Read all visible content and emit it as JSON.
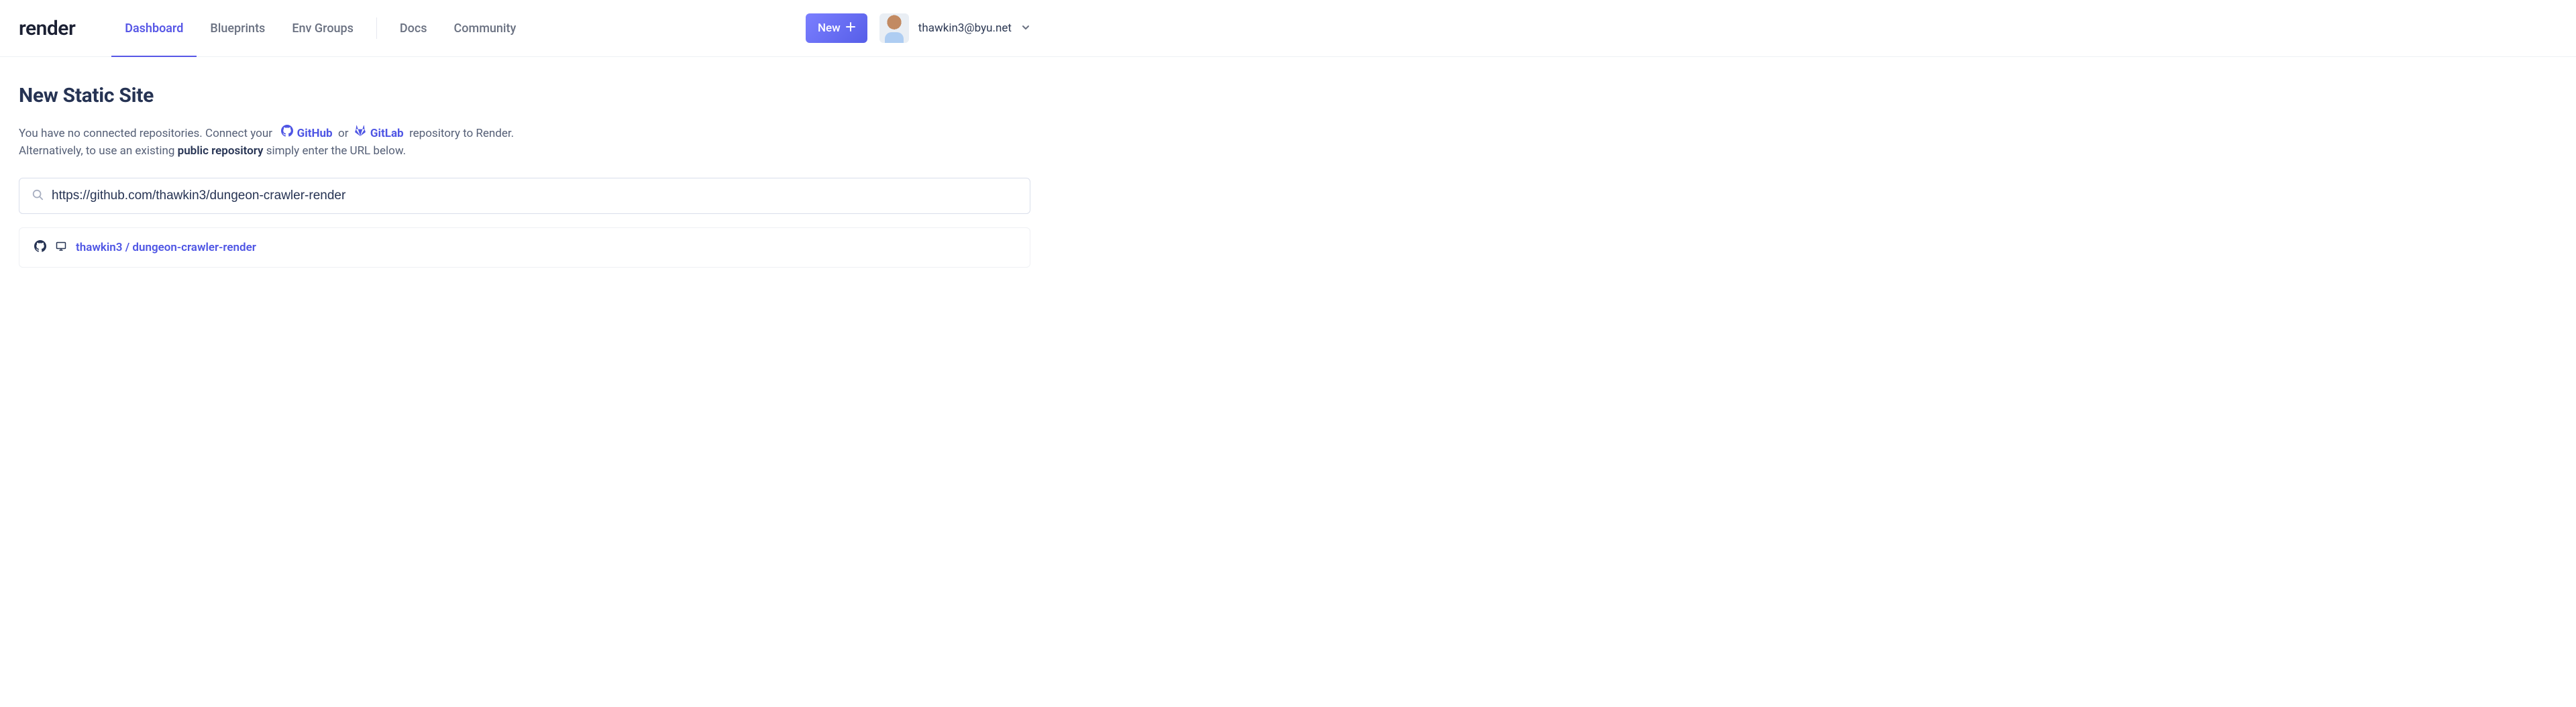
{
  "brand": "render",
  "nav": {
    "primary": [
      {
        "label": "Dashboard",
        "active": true
      },
      {
        "label": "Blueprints",
        "active": false
      },
      {
        "label": "Env Groups",
        "active": false
      }
    ],
    "secondary": [
      {
        "label": "Docs"
      },
      {
        "label": "Community"
      }
    ]
  },
  "new_button": {
    "label": "New"
  },
  "user": {
    "email": "thawkin3@byu.net"
  },
  "page": {
    "title": "New Static Site",
    "desc_prefix": "You have no connected repositories. Connect your",
    "github_label": "GitHub",
    "or_label": "or",
    "gitlab_label": "GitLab",
    "desc_suffix": "repository to Render.",
    "desc_line2_prefix": "Alternatively, to use an existing",
    "desc_line2_strong": "public repository",
    "desc_line2_suffix": "simply enter the URL below."
  },
  "search": {
    "value": "https://github.com/thawkin3/dungeon-crawler-render",
    "placeholder": ""
  },
  "result": {
    "repo": "thawkin3 / dungeon-crawler-render"
  }
}
